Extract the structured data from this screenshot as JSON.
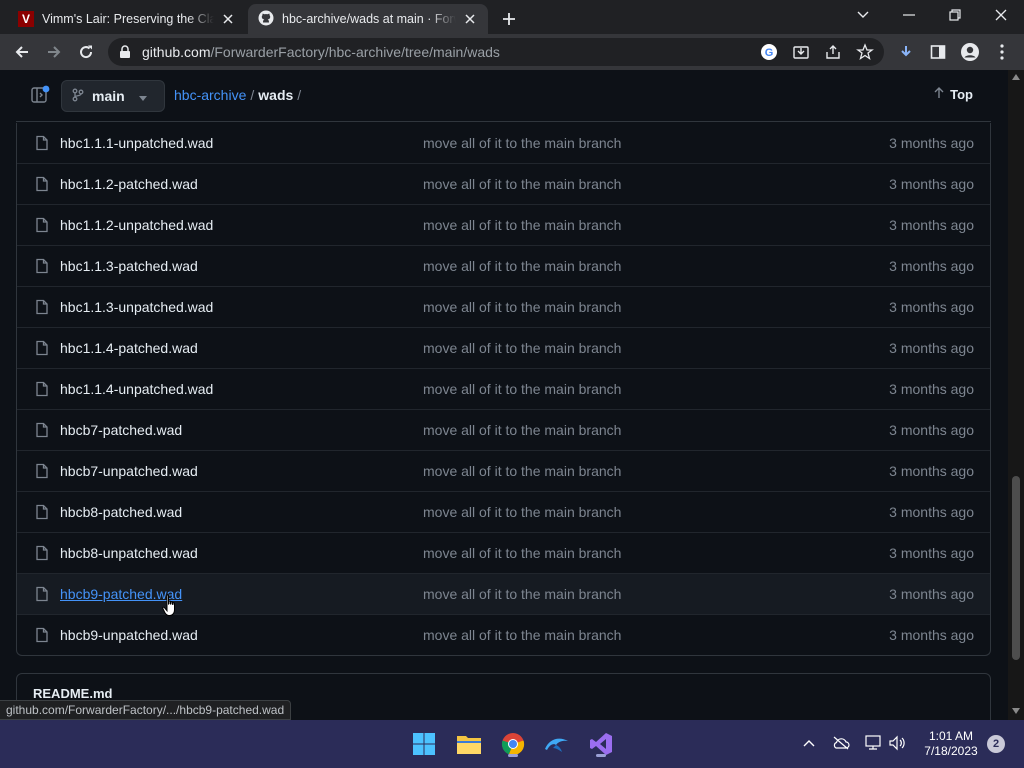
{
  "browser": {
    "tabs": [
      {
        "title": "Vimm's Lair: Preserving the Classics",
        "favicon": "vimm-favicon",
        "active": false
      },
      {
        "title": "hbc-archive/wads at main · ForwarderFactory",
        "favicon": "github-favicon",
        "active": true
      }
    ],
    "url_host": "github.com",
    "url_path": "/ForwarderFactory/hbc-archive/tree/main/wads"
  },
  "repo_header": {
    "branch": "main",
    "breadcrumb": {
      "repo": "hbc-archive",
      "sep1": "/",
      "folder": "wads",
      "sep2": "/"
    },
    "top_label": "Top"
  },
  "files": [
    {
      "name": "hbc1.1.1-unpatched.wad",
      "message": "move all of it to the main branch",
      "date": "3 months ago"
    },
    {
      "name": "hbc1.1.2-patched.wad",
      "message": "move all of it to the main branch",
      "date": "3 months ago"
    },
    {
      "name": "hbc1.1.2-unpatched.wad",
      "message": "move all of it to the main branch",
      "date": "3 months ago"
    },
    {
      "name": "hbc1.1.3-patched.wad",
      "message": "move all of it to the main branch",
      "date": "3 months ago"
    },
    {
      "name": "hbc1.1.3-unpatched.wad",
      "message": "move all of it to the main branch",
      "date": "3 months ago"
    },
    {
      "name": "hbc1.1.4-patched.wad",
      "message": "move all of it to the main branch",
      "date": "3 months ago"
    },
    {
      "name": "hbc1.1.4-unpatched.wad",
      "message": "move all of it to the main branch",
      "date": "3 months ago"
    },
    {
      "name": "hbcb7-patched.wad",
      "message": "move all of it to the main branch",
      "date": "3 months ago"
    },
    {
      "name": "hbcb7-unpatched.wad",
      "message": "move all of it to the main branch",
      "date": "3 months ago"
    },
    {
      "name": "hbcb8-patched.wad",
      "message": "move all of it to the main branch",
      "date": "3 months ago"
    },
    {
      "name": "hbcb8-unpatched.wad",
      "message": "move all of it to the main branch",
      "date": "3 months ago"
    },
    {
      "name": "hbcb9-patched.wad",
      "message": "move all of it to the main branch",
      "date": "3 months ago"
    },
    {
      "name": "hbcb9-unpatched.wad",
      "message": "move all of it to the main branch",
      "date": "3 months ago"
    }
  ],
  "readme": {
    "title": "README.md"
  },
  "status_url": "github.com/ForwarderFactory/.../hbcb9-patched.wad",
  "taskbar": {
    "apps": [
      "windows-start-icon",
      "file-explorer-icon",
      "chrome-icon",
      "dolphin-emulator-icon",
      "visual-studio-icon"
    ],
    "time": "1:01 AM",
    "date": "7/18/2023",
    "notification_count": "2"
  },
  "colors": {
    "accent_link": "#4493f8",
    "page_bg": "#0d1117",
    "taskbar_bg": "#2b2c58"
  }
}
